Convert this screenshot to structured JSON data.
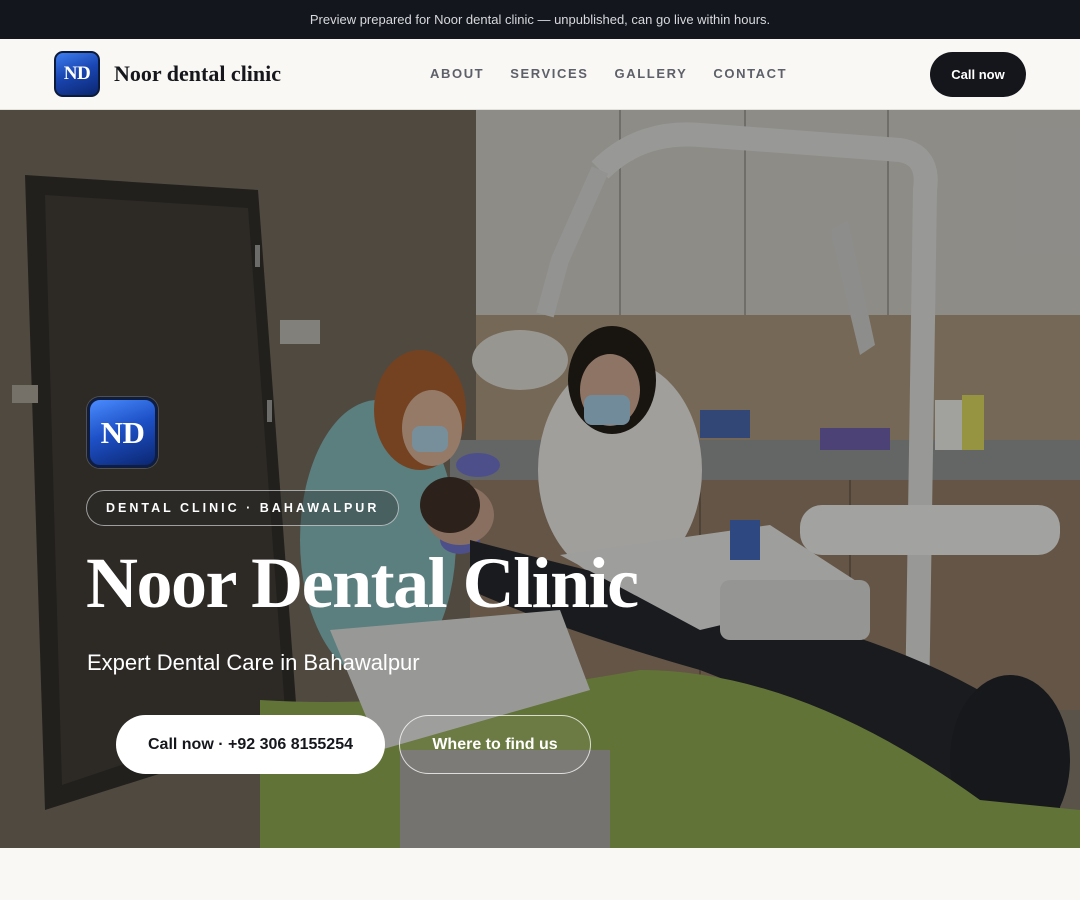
{
  "preview_bar": {
    "text": "Preview prepared for Noor dental clinic — unpublished, can go live within hours."
  },
  "nav": {
    "logo_text": "ND",
    "brand": "Noor dental clinic",
    "links": [
      "ABOUT",
      "SERVICES",
      "GALLERY",
      "CONTACT"
    ],
    "cta": "Call now"
  },
  "hero": {
    "logo_text": "ND",
    "badge": "DENTAL CLINIC · BAHAWALPUR",
    "title": "Noor Dental Clinic",
    "subtitle": "Expert Dental Care in Bahawalpur",
    "primary_button": "Call now · +92 306 8155254",
    "secondary_button": "Where to find us"
  },
  "colors": {
    "preview_bar_bg": "#13161c",
    "nav_bg": "#f9f8f5",
    "accent_dark": "#14161b",
    "logo_blue": "#1e51c8"
  },
  "icons": {
    "logo": "nd-monogram-icon"
  }
}
